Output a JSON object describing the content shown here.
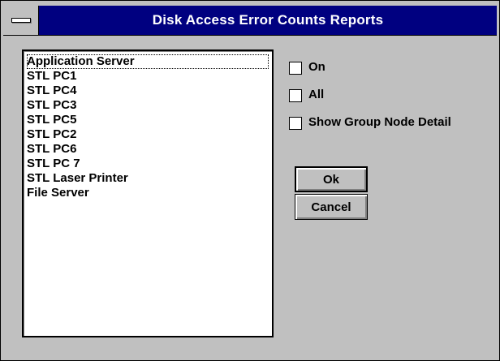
{
  "window": {
    "title": "Disk Access Error Counts Reports"
  },
  "list": {
    "items": [
      "Application Server",
      "STL PC1",
      "STL PC4",
      "STL PC3",
      "STL PC5",
      "STL PC2",
      "STL PC6",
      "STL PC 7",
      "STL Laser Printer",
      "File Server"
    ],
    "focused_index": 0
  },
  "options": {
    "on_label": "On",
    "on_checked": false,
    "all_label": "All",
    "all_checked": false,
    "group_detail_label": "Show Group Node Detail",
    "group_detail_checked": false
  },
  "buttons": {
    "ok_label": "Ok",
    "cancel_label": "Cancel"
  },
  "colors": {
    "titlebar": "#000080",
    "face": "#c0c0c0",
    "window_bg": "#ffffff"
  }
}
